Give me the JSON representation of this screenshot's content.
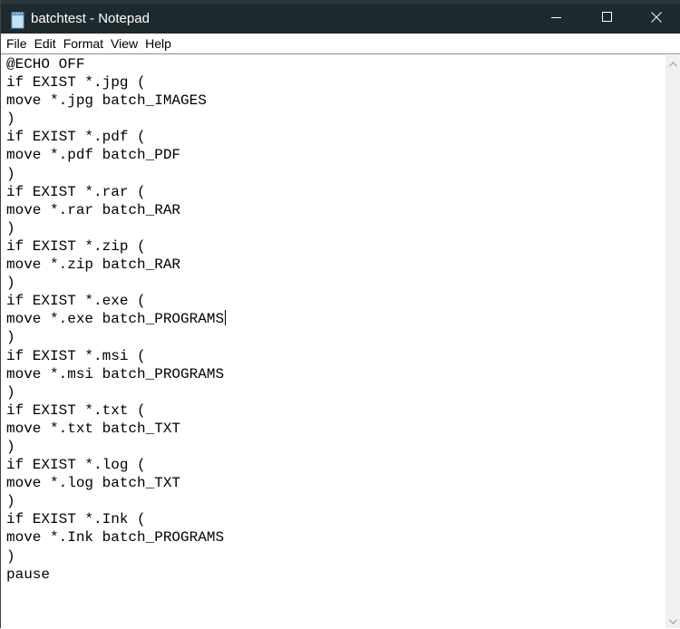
{
  "window": {
    "title": "batchtest - Notepad",
    "icon": "notepad-icon",
    "controls": {
      "minimize": "minimize-icon",
      "maximize": "maximize-icon",
      "close": "close-icon"
    }
  },
  "menu": {
    "items": [
      {
        "label": "File"
      },
      {
        "label": "Edit"
      },
      {
        "label": "Format"
      },
      {
        "label": "View"
      },
      {
        "label": "Help"
      }
    ]
  },
  "editor": {
    "lines": [
      "@ECHO OFF",
      "if EXIST *.jpg (",
      "move *.jpg batch_IMAGES",
      ")",
      "if EXIST *.pdf (",
      "move *.pdf batch_PDF",
      ")",
      "if EXIST *.rar (",
      "move *.rar batch_RAR",
      ")",
      "if EXIST *.zip (",
      "move *.zip batch_RAR",
      ")",
      "if EXIST *.exe (",
      "move *.exe batch_PROGRAMS",
      ")",
      "if EXIST *.msi (",
      "move *.msi batch_PROGRAMS",
      ")",
      "if EXIST *.txt (",
      "move *.txt batch_TXT",
      ")",
      "if EXIST *.log (",
      "move *.log batch_TXT",
      ")",
      "if EXIST *.Ink (",
      "move *.Ink batch_PROGRAMS",
      ")",
      "pause"
    ],
    "caret_line": 14
  },
  "scrollbar": {
    "up": "chevron-up-icon",
    "down": "chevron-down-icon"
  }
}
